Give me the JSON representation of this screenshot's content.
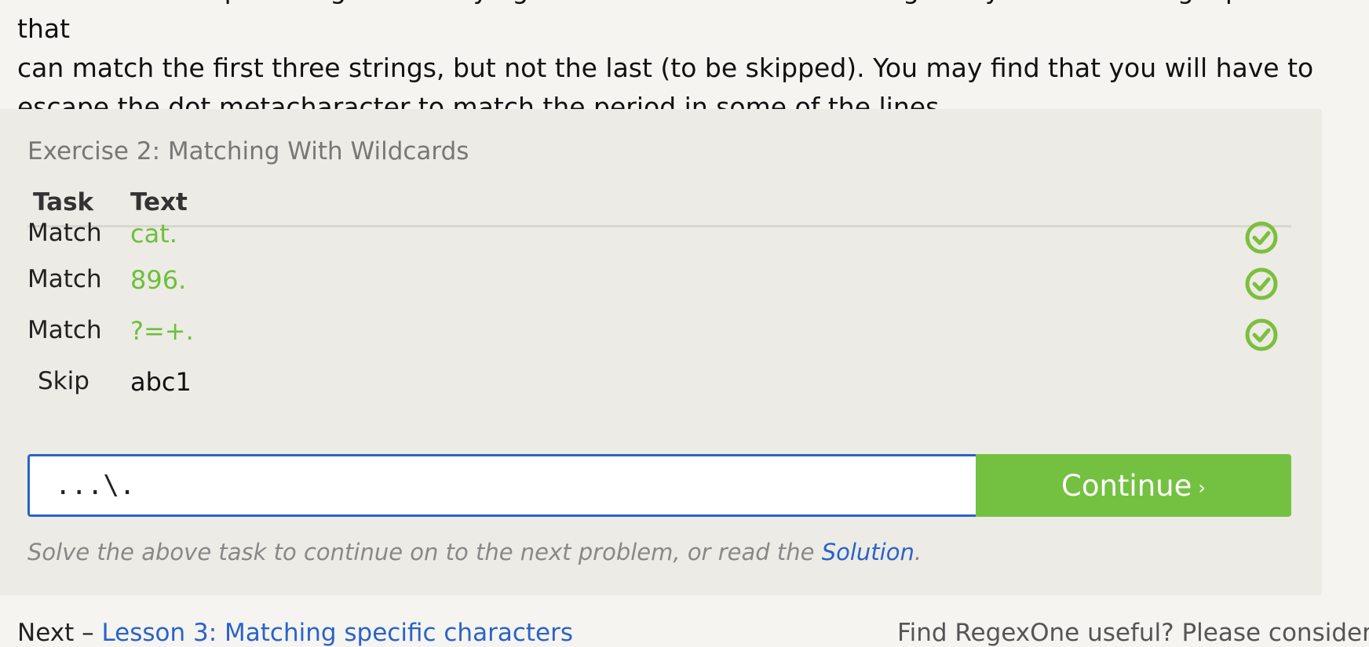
{
  "intro": {
    "line1": "Below are a couple strings with varying characters but the same length. Try to write a single pattern that",
    "line2": "can match the first three strings, but not the last (to be skipped). You may find that you will have to",
    "line3": "escape the dot metacharacter to match the period in some of the lines."
  },
  "exercise": {
    "title": "Exercise 2: Matching With Wildcards",
    "headers": {
      "task": "Task",
      "text": "Text"
    },
    "rows": [
      {
        "task": "Match",
        "text": "cat.",
        "status": "matched"
      },
      {
        "task": "Match",
        "text": "896.",
        "status": "matched"
      },
      {
        "task": "Match",
        "text": "?=+.",
        "status": "matched"
      },
      {
        "task": "Skip",
        "text": "abc1",
        "status": "none"
      }
    ],
    "input_value": "...\\.",
    "continue_label": "Continue",
    "continue_chevron": "›",
    "hint_prefix": "Solve the above task to continue on to the next problem, or read the ",
    "hint_link": "Solution",
    "hint_suffix": "."
  },
  "footer": {
    "next_prefix": "Next – ",
    "next_link": "Lesson 3: Matching specific characters",
    "right_text": "Find RegexOne useful? Please consider"
  },
  "colors": {
    "match_green": "#6dbf3b",
    "button_green": "#74c142",
    "link_blue": "#2a62c9",
    "panel_bg": "#edebe5"
  }
}
